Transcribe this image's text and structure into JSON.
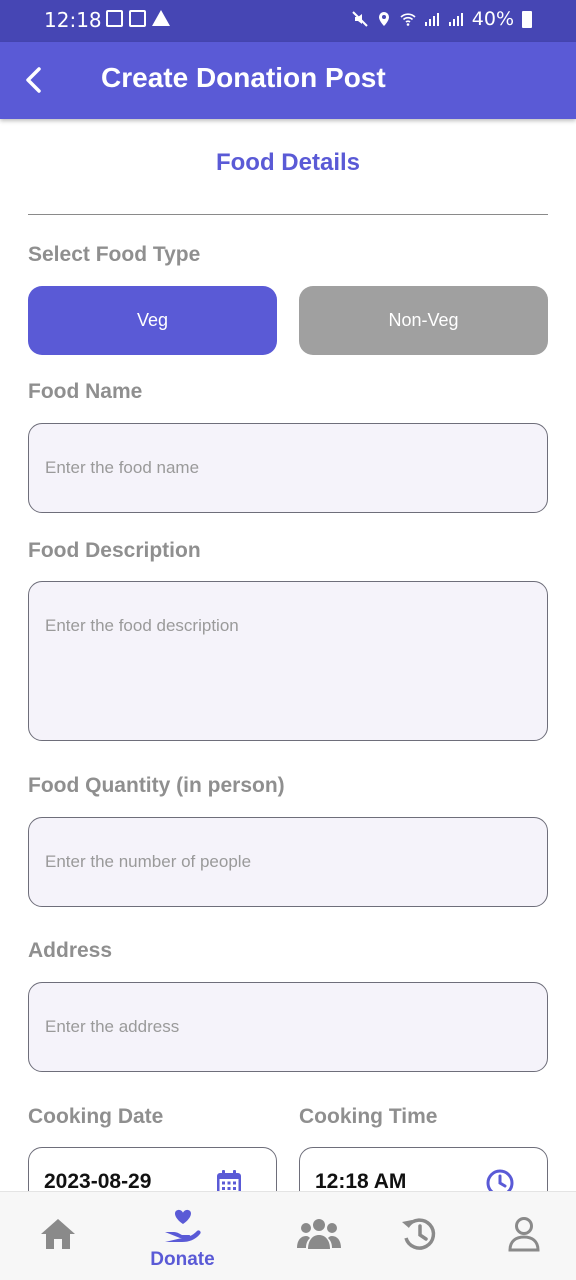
{
  "status_bar": {
    "time": "12:18",
    "battery": "40%"
  },
  "header": {
    "title": "Create Donation Post",
    "back_icon": "back-arrow-icon"
  },
  "form": {
    "section_title": "Food Details",
    "food_type_label": "Select Food Type",
    "food_type_options": [
      "Veg",
      "Non-Veg"
    ],
    "food_type_selected": "Veg",
    "food_name_label": "Food Name",
    "food_name_placeholder": "Enter the food name",
    "food_description_label": "Food Description",
    "food_description_placeholder": "Enter the food description",
    "food_quantity_label": "Food Quantity (in person)",
    "food_quantity_placeholder": "Enter the number of people",
    "address_label": "Address",
    "address_placeholder": "Enter the address",
    "cooking_date_label": "Cooking Date",
    "cooking_date_value": "2023-08-29",
    "cooking_time_label": "Cooking Time",
    "cooking_time_value": "12:18 AM"
  },
  "bottom_nav": {
    "active": "Donate",
    "items": [
      {
        "icon": "home-icon"
      },
      {
        "icon": "donate-hand-heart-icon",
        "label": "Donate"
      },
      {
        "icon": "community-icon"
      },
      {
        "icon": "history-icon"
      },
      {
        "icon": "profile-icon"
      }
    ]
  },
  "colors": {
    "primary": "#5a5ad6",
    "status_bar": "#4646b4",
    "inactive_button": "#a0a0a0",
    "label_gray": "#8f8f8f",
    "nav_inactive": "#8a8a8a"
  }
}
